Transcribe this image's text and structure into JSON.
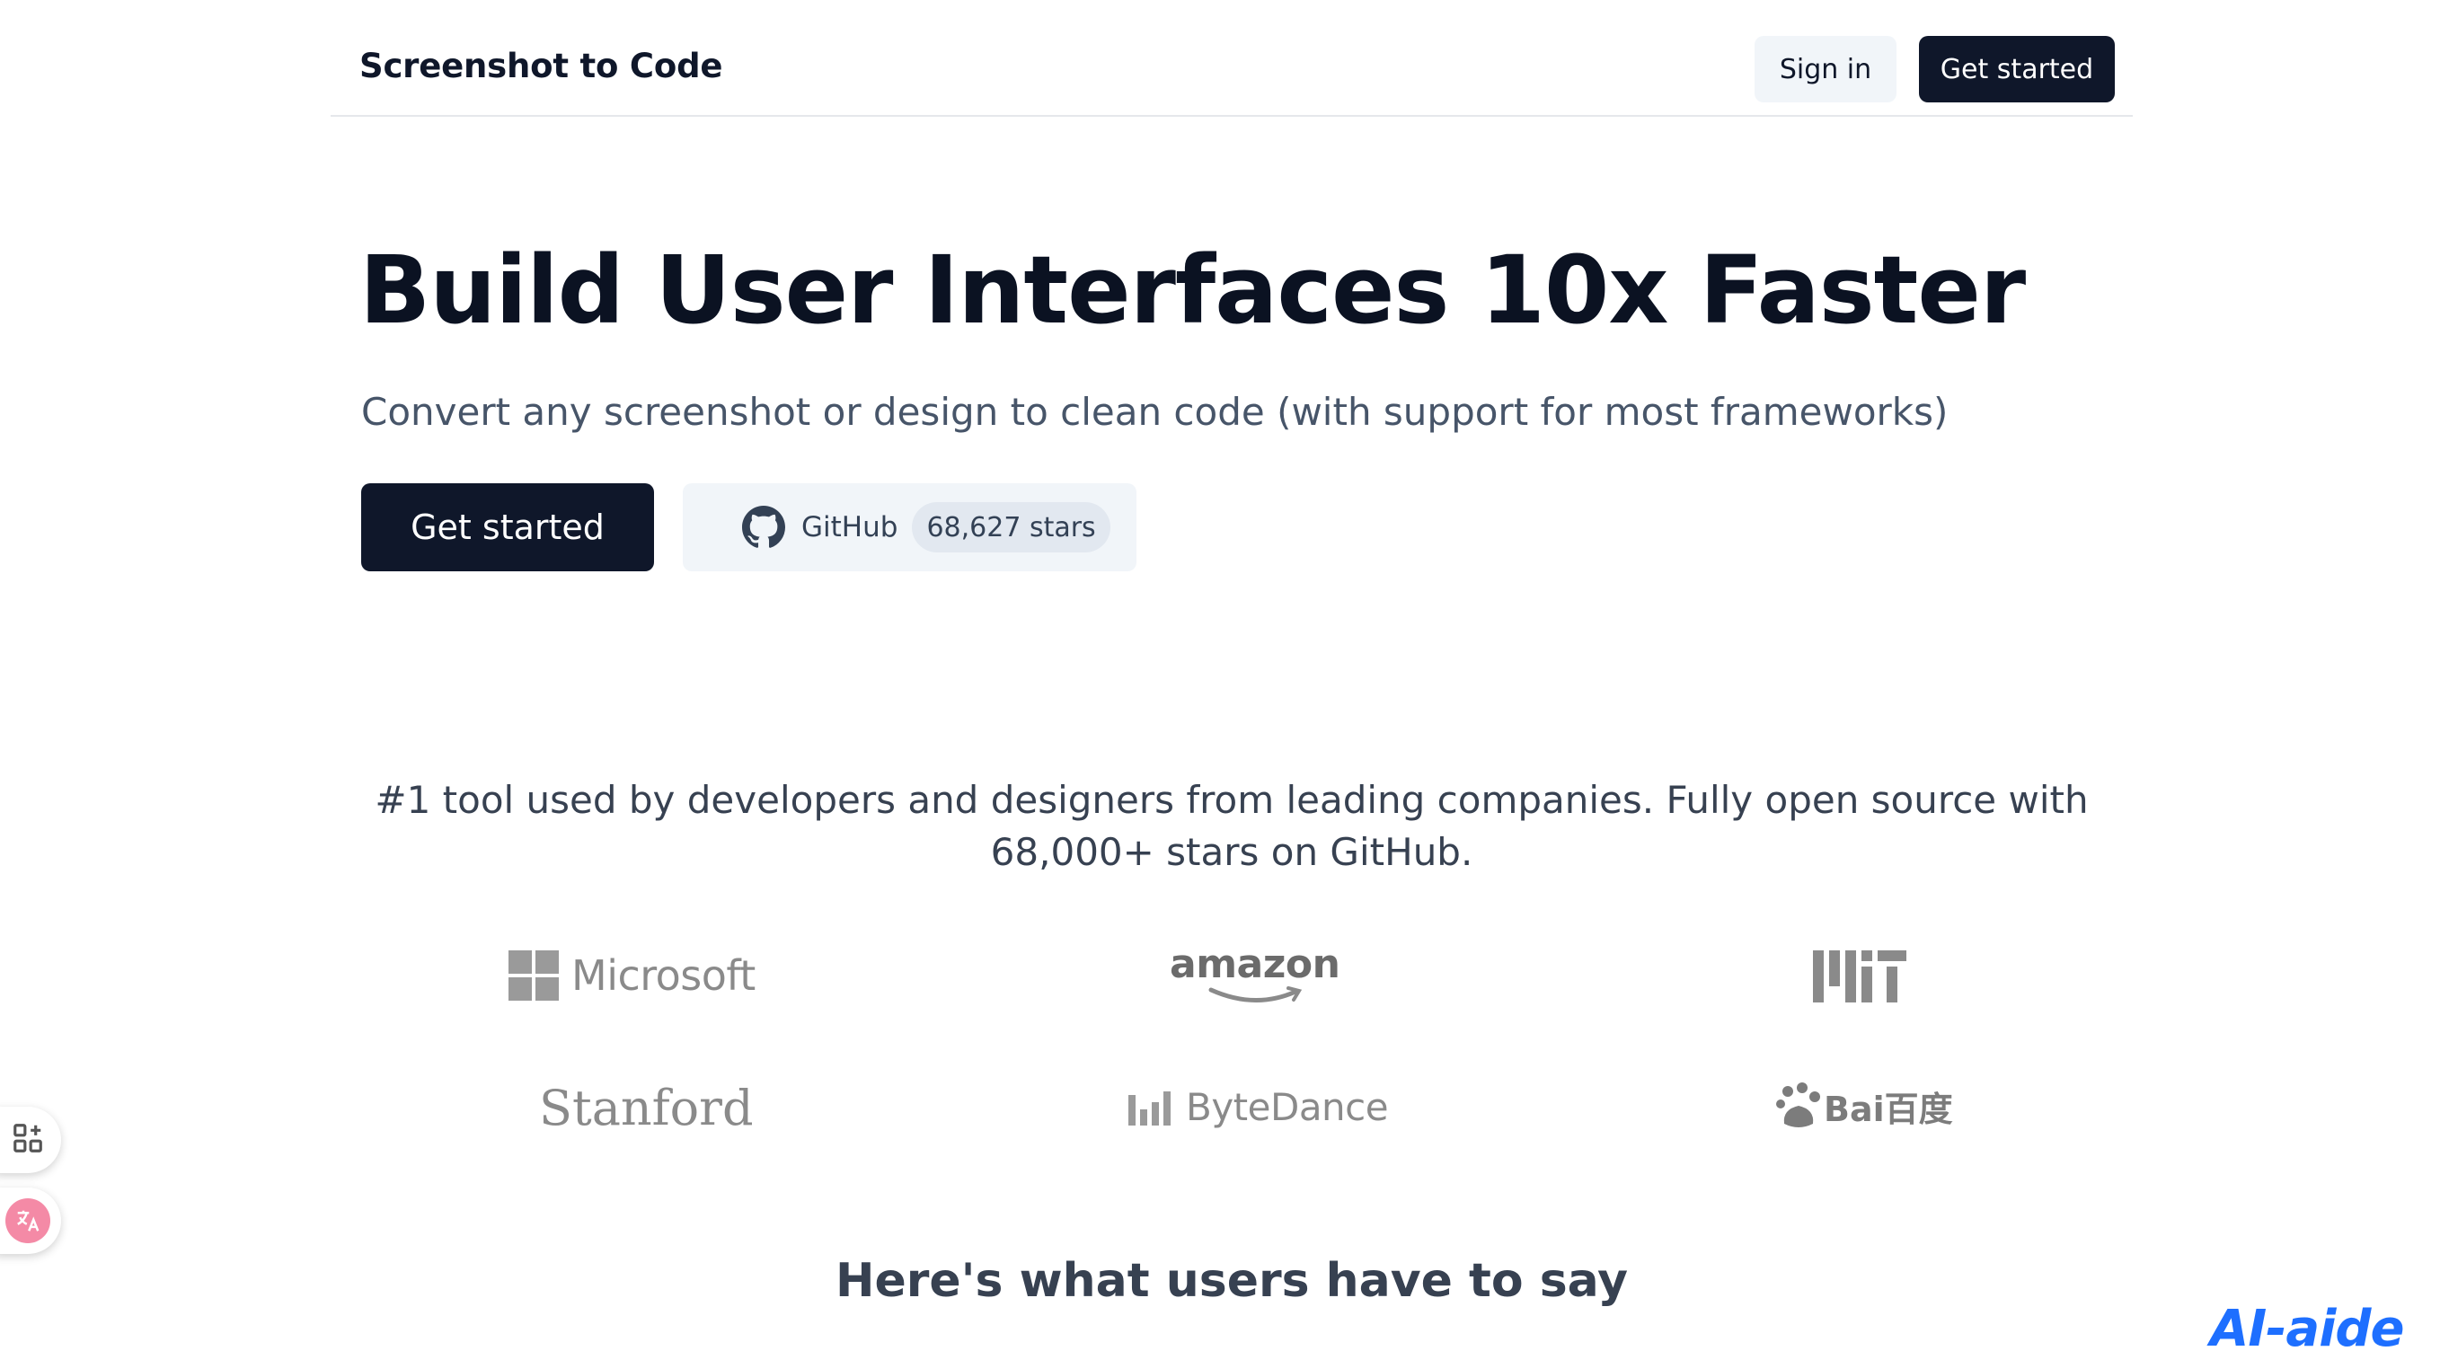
{
  "header": {
    "brand": "Screenshot to Code",
    "sign_in_label": "Sign in",
    "get_started_label": "Get started"
  },
  "hero": {
    "title": "Build User Interfaces 10x Faster",
    "subtitle": "Convert any screenshot or design to clean code (with support for most frameworks)",
    "primary_cta_label": "Get started",
    "github_label": "GitHub",
    "github_stars": "68,627 stars"
  },
  "social_proof": {
    "text": "#1 tool used by developers and designers from leading companies. Fully open source with 68,000+ stars on GitHub.",
    "logos": {
      "microsoft": "Microsoft",
      "amazon": "amazon",
      "mit": "MIT",
      "stanford": "Stanford",
      "bytedance": "ByteDance",
      "baidu": "Bai百度"
    }
  },
  "testimonials": {
    "title": "Here's what users have to say"
  },
  "side_widgets": {
    "apps_icon": "apps-icon",
    "translate_icon": "translate-icon"
  },
  "watermark": {
    "text": "AI-aide"
  },
  "colors": {
    "primary": "#0f172a",
    "secondary_bg": "#f1f5f9",
    "muted_text": "#475569",
    "logo_gray": "#8a8a8a",
    "watermark_blue": "#1e6fff",
    "translate_pink": "#f48aa6"
  }
}
